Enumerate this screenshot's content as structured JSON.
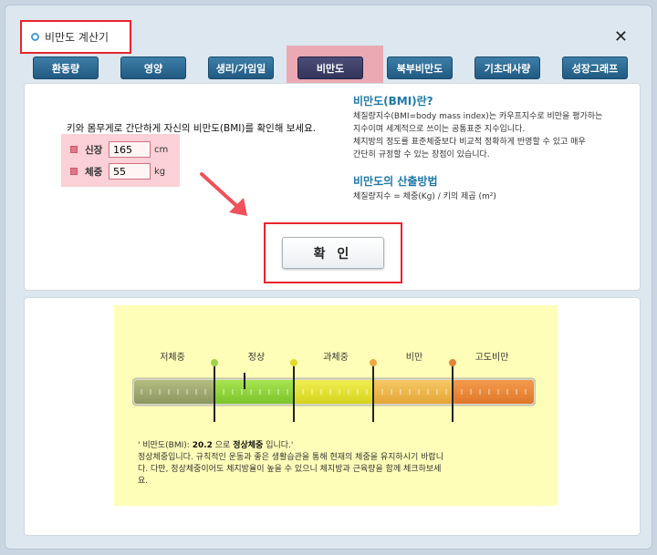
{
  "window": {
    "title": "비만도 계산기",
    "close": "✕"
  },
  "tabs": [
    "환동량",
    "영양",
    "생리/가임일",
    "비만도",
    "북부비만도",
    "기초대사량",
    "성장그래프"
  ],
  "active_tab_index": 3,
  "form": {
    "instruction": "키와 몸무게로 간단하게 자신의 비만도(BMI)를 확인해 보세요.",
    "height_label": "신장",
    "height_value": "165",
    "height_unit": "cm",
    "weight_label": "체중",
    "weight_value": "55",
    "weight_unit": "kg",
    "confirm_label": "확 인"
  },
  "info": {
    "title1": "비만도(BMI)란?",
    "line1": "체질량지수(BMI=body mass index)는 카우프지수로 비만을 평가하는",
    "line2": "지수이며 세계적으로 쓰이는 공통표준 지수입니다.",
    "line3": "체지방의 정도를 표준체중보다 비교적 정확하게 반영할 수 있고 매우",
    "line4": "간단히 규정할 수 있는 장점이 있습니다.",
    "title2": "비만도의 산출방법",
    "formula": "체질량지수 = 체중(Kg) / 키의 제곱 (m²)"
  },
  "result": {
    "categories": [
      "저체중",
      "정상",
      "과체중",
      "비만",
      "고도비만"
    ],
    "bmi_value": 20.2,
    "line1_prefix": "' 비만도(BMI): ",
    "line1_value": "20.2",
    "line1_mid": " 으로 ",
    "line1_status": "정상체중",
    "line1_suffix": " 입니다.'",
    "line2": "정상체중입니다. 규칙적인 운동과 좋은 생활습관을 통해 현재의 체중을 유지하시기 바랍니",
    "line3": "다. 다만, 정상체중이어도 체지방율이 높을 수 있으니 체지방과 근육량을 함께 체크하보세",
    "line4": "요."
  },
  "colors": {
    "accent_red": "#e8242b",
    "tab_blue": "#215a82",
    "tab_active": "#33345a",
    "info_title": "#1f78a8",
    "result_bg": "#fffeb8",
    "seg_underweight": "#9aa46a",
    "seg_normal": "#8fd43a",
    "seg_overweight": "#e6e32a",
    "seg_obese": "#f2b84a",
    "seg_severe": "#ee8a3a"
  }
}
